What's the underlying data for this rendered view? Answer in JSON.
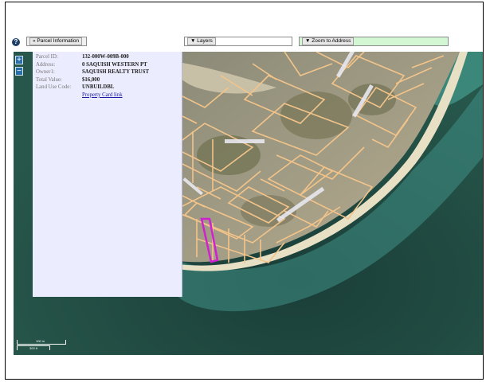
{
  "toolbar": {
    "help_icon": "question-circle-icon",
    "parcel_info_label": "« Parcel Information",
    "layers_label": "▼ Layers",
    "zoom_to_address_label": "▼ Zoom to Address"
  },
  "zoom": {
    "in": "+",
    "out": "−"
  },
  "parcel": {
    "rows": [
      {
        "key": "Parcel ID:",
        "value": "132-000W-009B-000"
      },
      {
        "key": "Address:",
        "value": "0 SAQUISH WESTERN PT"
      },
      {
        "key": "Owner1:",
        "value": "SAQUISH REALTY TRUST"
      },
      {
        "key": "Total Value:",
        "value": "$16,000"
      },
      {
        "key": "Land Use Code:",
        "value": "UNBUILDBL"
      }
    ],
    "link": "Property Card link"
  },
  "scale": {
    "top": "100 m",
    "bottom": "300 ft"
  },
  "colors": {
    "panel_bg": "#ececff",
    "parcel_lines": "#f3c48a",
    "selected_parcel": "#d020d0",
    "zoom_address_bg": "#d2f7d2"
  }
}
